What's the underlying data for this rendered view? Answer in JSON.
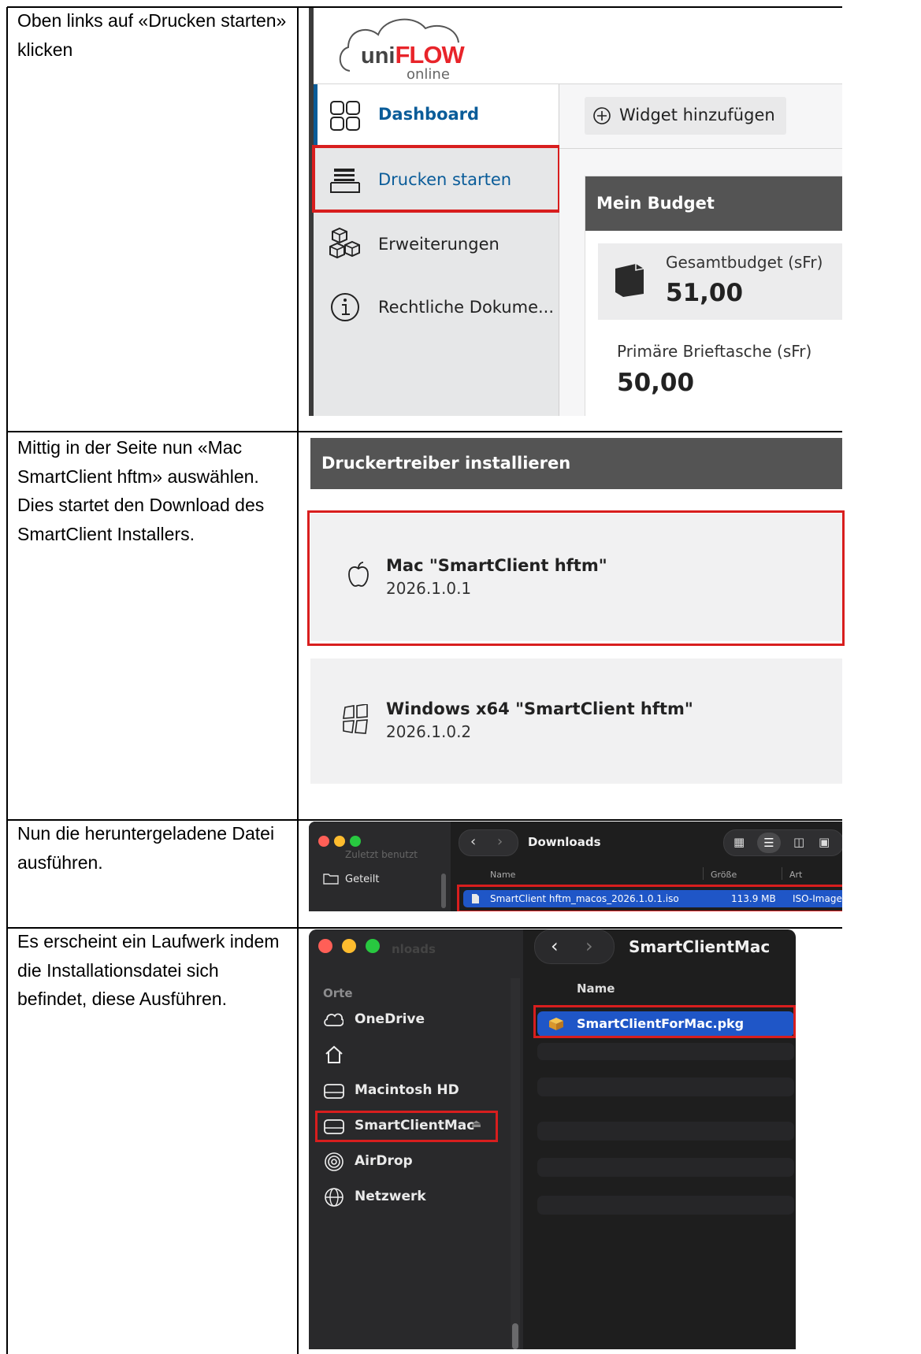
{
  "rows": [
    {
      "instruction": "Oben links auf «Drucken starten» klicken"
    },
    {
      "instruction": "Mittig in der Seite nun «Mac SmartClient hftm» auswählen. Dies startet den Download des SmartClient Installers."
    },
    {
      "instruction": "Nun die heruntergeladene Datei ausführen."
    },
    {
      "instruction": "Es erscheint ein Laufwerk indem die Installationsdatei sich befindet, diese Ausführen."
    }
  ],
  "uniflow": {
    "logo_uni": "uni",
    "logo_flow": "FLOW",
    "logo_online": "online",
    "nav": [
      {
        "label": "Dashboard",
        "icon": "dashboard-grid-icon"
      },
      {
        "label": "Drucken starten",
        "icon": "printer-tray-icon"
      },
      {
        "label": "Erweiterungen",
        "icon": "cubes-icon"
      },
      {
        "label": "Rechtliche Dokume...",
        "icon": "info-circle-icon"
      }
    ],
    "widget_button": "Widget hinzufügen",
    "budget_title": "Mein Budget",
    "total_label": "Gesamtbudget (sFr)",
    "total_value": "51,00",
    "wallet_label": "Primäre Brieftasche (sFr)",
    "wallet_value": "50,00",
    "colors": {
      "accent": "#0a5c99",
      "red": "#d81e1e",
      "header_dark": "#545454",
      "sidebar": "#e6e7e8"
    }
  },
  "drivers": {
    "header": "Druckertreiber installieren",
    "items": [
      {
        "name": "Mac \"SmartClient hftm\"",
        "version": "2026.1.0.1",
        "icon": "apple-icon"
      },
      {
        "name": "Windows x64 \"SmartClient hftm\"",
        "version": "2026.1.0.2",
        "icon": "windows-icon"
      }
    ]
  },
  "finder_downloads": {
    "sidebar_recent": "Zuletzt benutzt",
    "sidebar_shared": "Geteilt",
    "title": "Downloads",
    "col_name": "Name",
    "col_size": "Größe",
    "col_kind": "Art",
    "file_name": "SmartClient hftm_macos_2026.1.0.1.iso",
    "file_size": "113.9 MB",
    "file_kind": "ISO-Image"
  },
  "finder_volume": {
    "sidebar_section": "Orte",
    "sidebar_faded": "nloads",
    "locations": [
      {
        "label": "OneDrive",
        "icon": "cloud-icon"
      },
      {
        "label": "",
        "icon": "home-icon"
      },
      {
        "label": "Macintosh HD",
        "icon": "drive-icon"
      },
      {
        "label": "SmartClientMac",
        "icon": "drive-icon"
      },
      {
        "label": "AirDrop",
        "icon": "airdrop-icon"
      },
      {
        "label": "Netzwerk",
        "icon": "network-globe-icon"
      }
    ],
    "title": "SmartClientMac",
    "col_name": "Name",
    "file_name": "SmartClientForMac.pkg"
  }
}
